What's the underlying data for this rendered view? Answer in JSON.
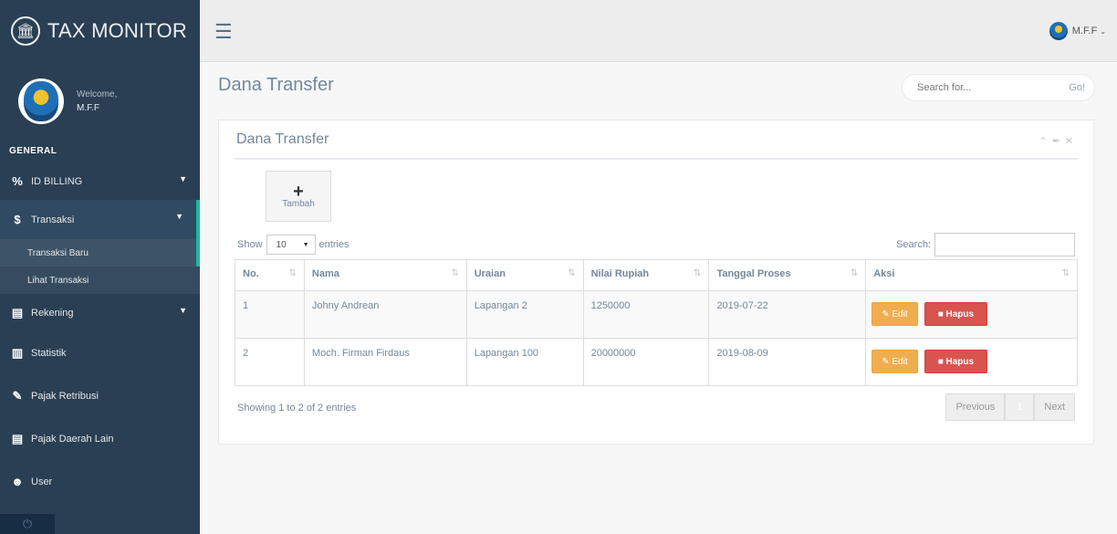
{
  "brand": {
    "title": "TAX MONITOR"
  },
  "profile": {
    "welcome": "Welcome,",
    "name": "M.F.F"
  },
  "sidebar": {
    "section": "GENERAL",
    "items": [
      {
        "label": "ID BILLING",
        "icon": "percent-icon"
      },
      {
        "label": "Transaksi",
        "icon": "dollar-icon"
      },
      {
        "label": "Rekening",
        "icon": "card-icon"
      },
      {
        "label": "Statistik",
        "icon": "bar-chart-icon"
      },
      {
        "label": "Pajak Retribusi",
        "icon": "edit-icon"
      },
      {
        "label": "Pajak Daerah Lain",
        "icon": "list-icon"
      },
      {
        "label": "User",
        "icon": "users-icon"
      }
    ],
    "subitems": [
      {
        "label": "Transaksi Baru"
      },
      {
        "label": "Lihat Transaksi"
      }
    ]
  },
  "topnav": {
    "user": "M.F.F"
  },
  "page": {
    "title": "Dana Transfer"
  },
  "search": {
    "placeholder": "Search for...",
    "go": "Go!"
  },
  "panel": {
    "title": "Dana Transfer"
  },
  "add_button": {
    "label": "Tambah"
  },
  "datatable": {
    "show_label": "Show",
    "page_size": "10",
    "entries_label": "entries",
    "search_label": "Search:",
    "columns": [
      "No.",
      "Nama",
      "Uraian",
      "Nilai Rupiah",
      "Tanggal Proses",
      "Aksi"
    ],
    "rows": [
      {
        "no": "1",
        "nama": "Johny Andrean",
        "uraian": "Lapangan 2",
        "nilai": "1250000",
        "tanggal": "2019-07-22"
      },
      {
        "no": "2",
        "nama": "Moch. Firman Firdaus",
        "uraian": "Lapangan 100",
        "nilai": "20000000",
        "tanggal": "2019-08-09"
      }
    ],
    "edit_label": "Edit",
    "delete_label": "Hapus",
    "info": "Showing 1 to 2 of 2 entries",
    "prev": "Previous",
    "current_page": "1",
    "next": "Next"
  },
  "colors": {
    "sidebar": "#2a3f54",
    "accent": "#1abb9c",
    "edit": "#f0ad4e",
    "delete": "#d9534f"
  }
}
